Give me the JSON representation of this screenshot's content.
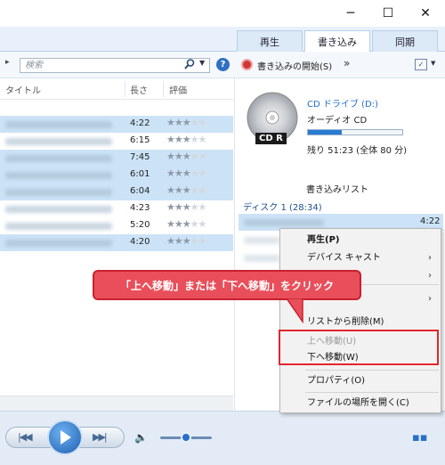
{
  "window": {
    "minimize": "─",
    "maximize": "☐",
    "close": "✕"
  },
  "tabs": [
    {
      "label": "再生"
    },
    {
      "label": "書き込み"
    },
    {
      "label": "同期"
    }
  ],
  "toolbar": {
    "search_placeholder": "検索",
    "burn_start": "書き込みの開始(S)",
    "more": "»"
  },
  "library": {
    "headers": {
      "title": "タイトル",
      "length": "長さ",
      "rating": "評価"
    },
    "rows": [
      {
        "length": "4:22",
        "rating": 3,
        "selected": true
      },
      {
        "length": "6:15",
        "rating": 3,
        "selected": false
      },
      {
        "length": "7:45",
        "rating": 3,
        "selected": true
      },
      {
        "length": "6:01",
        "rating": 3,
        "selected": true
      },
      {
        "length": "6:04",
        "rating": 3,
        "selected": true
      },
      {
        "length": "4:23",
        "rating": 3,
        "selected": false
      },
      {
        "length": "5:20",
        "rating": 3,
        "selected": false
      },
      {
        "length": "4:20",
        "rating": 3,
        "selected": true
      }
    ]
  },
  "drive": {
    "name": "CD ドライブ (D:)",
    "type": "オーディオ CD",
    "disc_label": "CD R",
    "remaining": "残り 51:23 (全体 80 分)",
    "used_fraction": 0.36
  },
  "burn_list": {
    "title": "書き込みリスト",
    "disc": "ディスク 1 (28:34)",
    "first_length": "4:22"
  },
  "context_menu": {
    "items": [
      {
        "label": "再生(P)",
        "enabled": true,
        "bold": true
      },
      {
        "label": "デバイス キャスト",
        "enabled": true,
        "submenu": true
      },
      {
        "label": "",
        "enabled": true,
        "submenu": true
      },
      {
        "label": "",
        "enabled": true,
        "submenu": true
      },
      {
        "label": "リストから削除(M)",
        "enabled": true
      },
      {
        "label": "上へ移動(U)",
        "enabled": false
      },
      {
        "label": "下へ移動(W)",
        "enabled": true
      },
      {
        "label": "プロパティ(O)",
        "enabled": true
      },
      {
        "label": "ファイルの場所を開く(C)",
        "enabled": true
      }
    ]
  },
  "callout": {
    "text": "「上へ移動」または「下へ移動」をクリック"
  },
  "colors": {
    "accent": "#1f6fd1",
    "callout": "#e94f5a",
    "highlight": "#e3262d",
    "selection": "#cce3f7"
  }
}
